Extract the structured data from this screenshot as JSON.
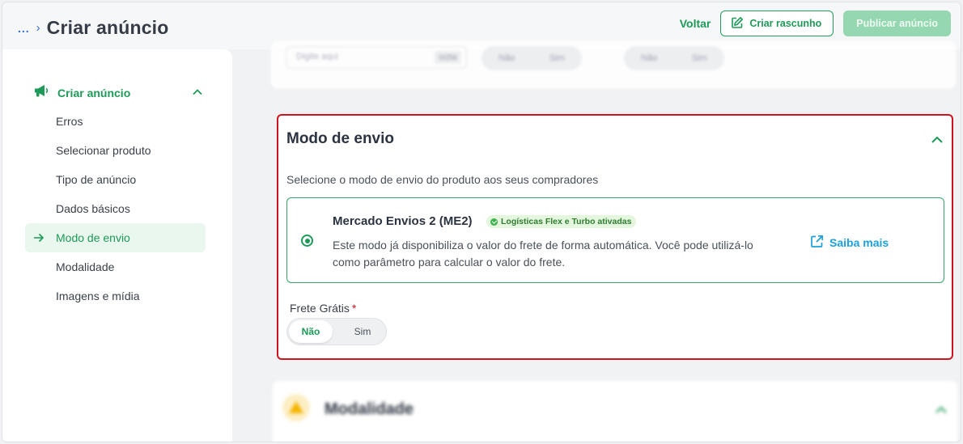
{
  "header": {
    "breadcrumb_ellipsis": "...",
    "breadcrumb_separator": "›",
    "title": "Criar anúncio",
    "back_label": "Voltar",
    "draft_label": "Criar rascunho",
    "publish_label": "Publicar anúncio"
  },
  "sidebar": {
    "section_label": "Criar anúncio",
    "items": [
      {
        "label": "Erros",
        "active": false
      },
      {
        "label": "Selecionar produto",
        "active": false
      },
      {
        "label": "Tipo de anúncio",
        "active": false
      },
      {
        "label": "Dados básicos",
        "active": false
      },
      {
        "label": "Modo de envio",
        "active": true
      },
      {
        "label": "Modalidade",
        "active": false
      },
      {
        "label": "Imagens e mídia",
        "active": false
      }
    ]
  },
  "top_card": {
    "input_placeholder": "Digite aqui",
    "char_count": "0/256",
    "toggle_a": {
      "no": "Não",
      "yes": "Sim"
    },
    "toggle_b": {
      "no": "Não",
      "yes": "Sim"
    }
  },
  "shipping": {
    "title": "Modo de envio",
    "description": "Selecione o modo de envio do produto aos seus compradores",
    "option": {
      "title": "Mercado Envios 2 (ME2)",
      "badge": "Logísticas Flex e Turbo ativadas",
      "description": "Este modo já disponibiliza o valor do frete de forma automática. Você pode utilizá-lo como parâmetro para calcular o valor do frete.",
      "learn_more": "Saiba mais",
      "selected": true
    },
    "free_shipping_label": "Frete Grátis",
    "required_mark": "*",
    "toggle": {
      "no": "Não",
      "yes": "Sim",
      "selected": "Não"
    }
  },
  "next_section": {
    "title": "Modalidade"
  },
  "colors": {
    "brand_green": "#1d9a57",
    "highlight_border": "#d0141f",
    "link_blue": "#1ca0d9"
  }
}
